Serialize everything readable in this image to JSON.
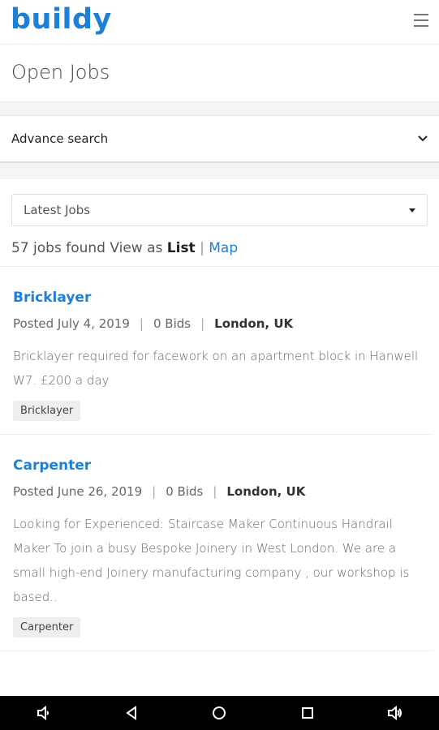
{
  "app": {
    "logo": "buildy"
  },
  "header": {
    "menu_icon": "hamburger-menu-icon"
  },
  "page": {
    "title": "Open Jobs"
  },
  "advanced_search": {
    "label": "Advance search",
    "icon": "chevron-down-icon"
  },
  "filter": {
    "sort_selected": "Latest Jobs"
  },
  "results": {
    "count_text": "57 jobs found View as",
    "view_list": "List",
    "separator": "|",
    "view_map": "Map"
  },
  "jobs": [
    {
      "title": "Bricklayer",
      "posted": "Posted July 4, 2019",
      "bids": "0 Bids",
      "location": "London, UK",
      "description": "Bricklayer required for facework on an apartment block in Hanwell W7. £200 a day",
      "tag": "Bricklayer"
    },
    {
      "title": "Carpenter",
      "posted": "Posted June 26, 2019",
      "bids": "0 Bids",
      "location": "London, UK",
      "description": "Looking for Experienced: Staircase Maker Continuous Handrail Maker To join a busy Bespoke Joinery in West London. We are a small high-end Joinery manufacturing company , our workshop is based..",
      "tag": "Carpenter"
    }
  ],
  "navbar": {
    "icons": [
      "volume-down-icon",
      "back-icon",
      "home-icon",
      "recents-icon",
      "volume-up-icon"
    ]
  },
  "colors": {
    "brand": "#1e7fd6"
  }
}
